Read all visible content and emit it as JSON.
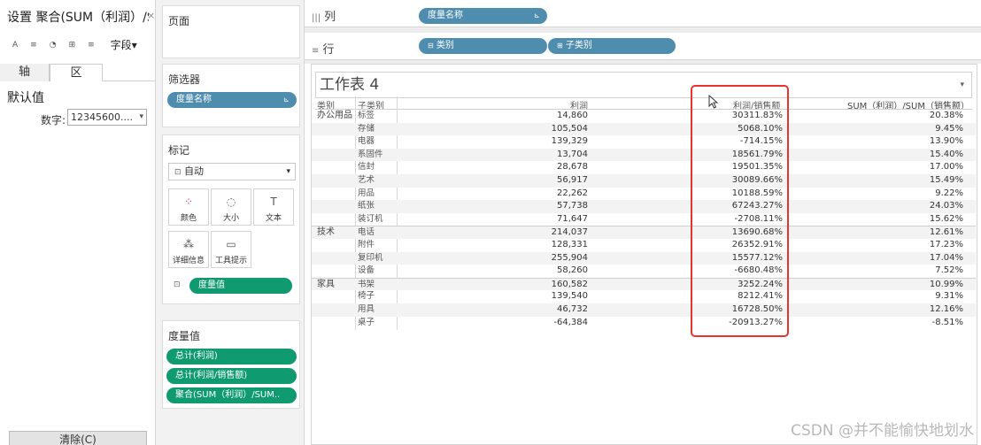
{
  "format_pane": {
    "title": "设置 聚合(SUM（利润）/SUM（销售额)) 的格式",
    "close_icon": "×",
    "toolbar": {
      "font_icon": "A",
      "align_icon": "≡",
      "shading_icon": "◔",
      "borders_icon": "⊞",
      "lines_icon": "≡",
      "field_label": "字段"
    },
    "tabs": {
      "axis": "轴",
      "pane": "区"
    },
    "default_label": "默认值",
    "number_label": "数字:",
    "number_value": "12345600....",
    "clear_button": "清除(C)"
  },
  "cards": {
    "pages": {
      "title": "页面"
    },
    "filters": {
      "title": "筛选器",
      "pill": "度量名称"
    },
    "marks": {
      "title": "标记",
      "type": "自动",
      "buttons": [
        {
          "label": "颜色",
          "icon": "color-icon"
        },
        {
          "label": "大小",
          "icon": "size-icon"
        },
        {
          "label": "文本",
          "icon": "text-icon"
        },
        {
          "label": "详细信息",
          "icon": "detail-icon"
        },
        {
          "label": "工具提示",
          "icon": "tooltip-icon"
        }
      ],
      "field_pill": "度量值"
    },
    "measure_values": {
      "title": "度量值",
      "pills": [
        "总计(利润)",
        "总计(利润/销售额)",
        "聚合(SUM（利润）/SUM.."
      ]
    }
  },
  "shelves": {
    "columns": {
      "label": "列",
      "pills": [
        "度量名称"
      ]
    },
    "rows": {
      "label": "行",
      "pills": [
        "类别",
        "子类别"
      ]
    }
  },
  "worksheet": {
    "title": "工作表 4",
    "headers": {
      "category": "类别",
      "subcategory": "子类别",
      "profit": "利润",
      "ratio": "利润/销售额",
      "agg": "SUM（利润）/SUM（销售额）"
    },
    "groups": [
      {
        "category": "办公用品",
        "rows": [
          {
            "sub": "标签",
            "profit": "14,860",
            "ratio": "30311.83%",
            "agg": "20.38%"
          },
          {
            "sub": "存储",
            "profit": "105,504",
            "ratio": "5068.10%",
            "agg": "9.45%"
          },
          {
            "sub": "电器",
            "profit": "139,329",
            "ratio": "-714.15%",
            "agg": "13.90%"
          },
          {
            "sub": "系固件",
            "profit": "13,704",
            "ratio": "18561.79%",
            "agg": "15.40%"
          },
          {
            "sub": "信封",
            "profit": "28,678",
            "ratio": "19501.35%",
            "agg": "17.00%"
          },
          {
            "sub": "艺术",
            "profit": "56,917",
            "ratio": "30089.66%",
            "agg": "15.49%"
          },
          {
            "sub": "用品",
            "profit": "22,262",
            "ratio": "10188.59%",
            "agg": "9.22%"
          },
          {
            "sub": "纸张",
            "profit": "57,738",
            "ratio": "67243.27%",
            "agg": "24.03%"
          },
          {
            "sub": "装订机",
            "profit": "71,647",
            "ratio": "-2708.11%",
            "agg": "15.62%"
          }
        ]
      },
      {
        "category": "技术",
        "rows": [
          {
            "sub": "电话",
            "profit": "214,037",
            "ratio": "13690.68%",
            "agg": "12.61%"
          },
          {
            "sub": "附件",
            "profit": "128,331",
            "ratio": "26352.91%",
            "agg": "17.23%"
          },
          {
            "sub": "复印机",
            "profit": "255,904",
            "ratio": "15577.12%",
            "agg": "17.04%"
          },
          {
            "sub": "设备",
            "profit": "58,260",
            "ratio": "-6680.48%",
            "agg": "7.52%"
          }
        ]
      },
      {
        "category": "家具",
        "rows": [
          {
            "sub": "书架",
            "profit": "160,582",
            "ratio": "3252.24%",
            "agg": "10.99%"
          },
          {
            "sub": "椅子",
            "profit": "139,540",
            "ratio": "8212.41%",
            "agg": "9.31%"
          },
          {
            "sub": "用具",
            "profit": "46,732",
            "ratio": "16728.50%",
            "agg": "12.16%"
          },
          {
            "sub": "桌子",
            "profit": "-64,384",
            "ratio": "-20913.27%",
            "agg": "-8.51%"
          }
        ]
      }
    ]
  },
  "watermark": "CSDN @并不能愉快地划水",
  "colors": {
    "blue_pill": "#4e8dae",
    "green_pill": "#109a70",
    "highlight": "#e8332e"
  }
}
